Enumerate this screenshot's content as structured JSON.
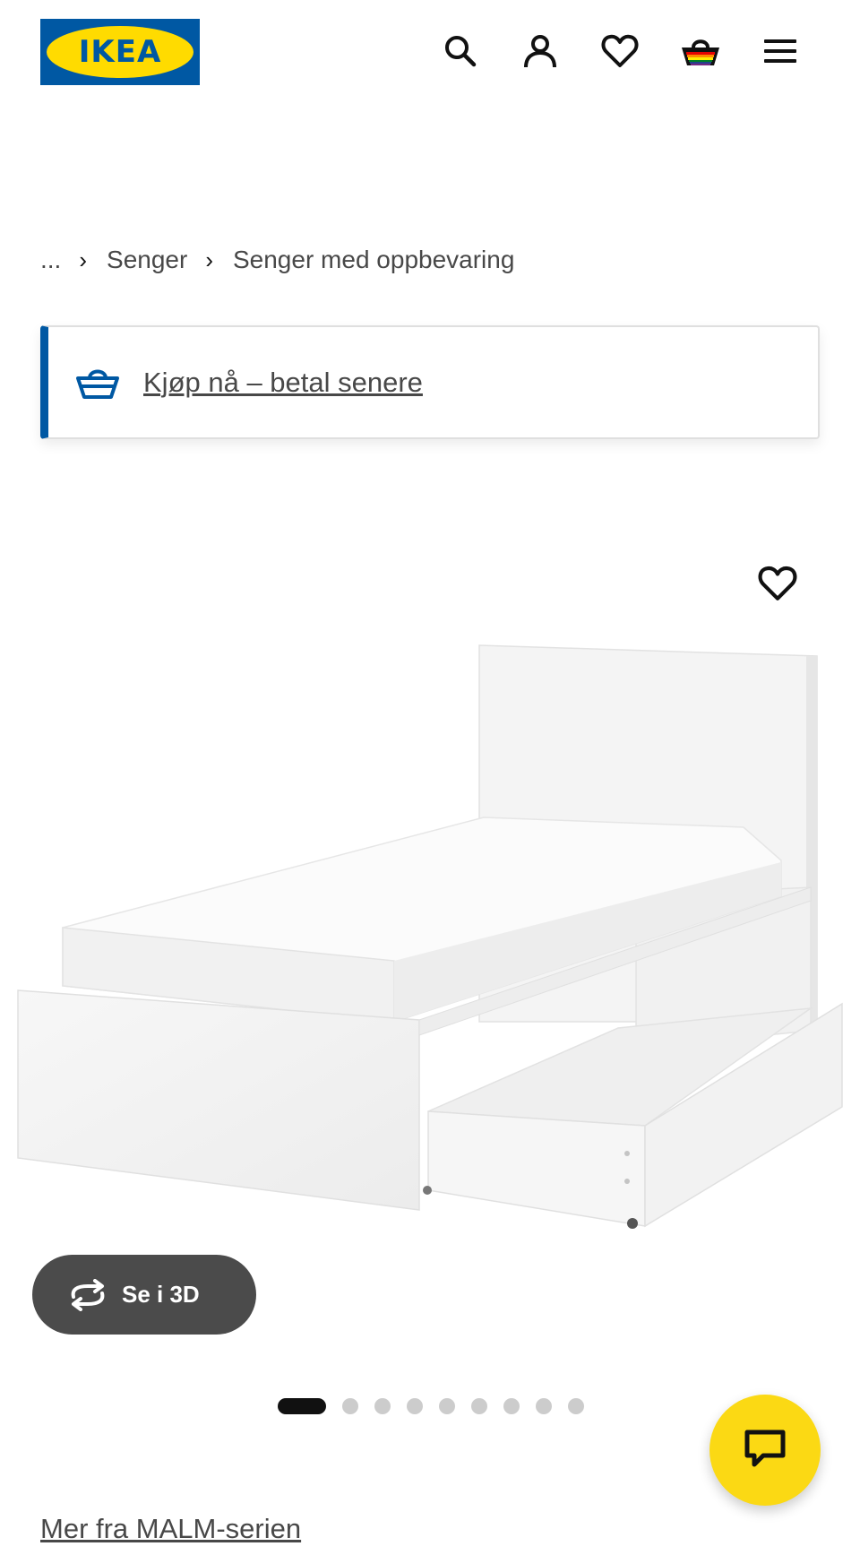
{
  "header": {
    "logo_text": "IKEA",
    "icons": [
      "search-icon",
      "user-icon",
      "heart-icon",
      "basket-icon",
      "menu-icon"
    ]
  },
  "breadcrumb": {
    "ellipsis": "...",
    "items": [
      "Senger",
      "Senger med oppbevaring"
    ],
    "separator": "›"
  },
  "promo": {
    "link_text": "Kjøp nå – betal senere",
    "icon": "basket-icon",
    "accent_color": "#0058a3"
  },
  "gallery": {
    "view_3d_label": "Se i 3D",
    "total_images": 9,
    "active_index": 0
  },
  "series_link": "Mer fra MALM-serien",
  "colors": {
    "brand_blue": "#0058a3",
    "brand_yellow": "#ffdb00",
    "chat_yellow": "#fbd914",
    "button_dark": "#4b4b4b"
  }
}
